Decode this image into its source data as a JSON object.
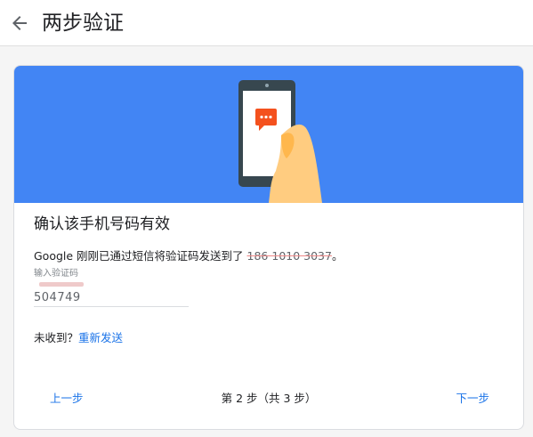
{
  "header": {
    "title": "两步验证",
    "back_icon": "arrow-back-icon"
  },
  "hero": {
    "background": "#4285f4",
    "illustration": "phone-sms-illustration",
    "message_icon": "chat-bubble-icon"
  },
  "card": {
    "title": "确认该手机号码有效",
    "description_prefix": "Google 刚刚已通过短信将验证码发送到了 ",
    "phone_redacted": "186 1010 3037",
    "description_suffix": "。",
    "code_field": {
      "label": "输入验证码",
      "value": "504749"
    },
    "resend": {
      "prompt": "未收到？",
      "link_label": "重新发送"
    }
  },
  "footer": {
    "prev_label": "上一步",
    "step_text": "第 2 步（共 3 步）",
    "next_label": "下一步"
  },
  "colors": {
    "accent": "#1a73e8",
    "hero_blue": "#4285f4",
    "message_orange": "#f4511e"
  }
}
